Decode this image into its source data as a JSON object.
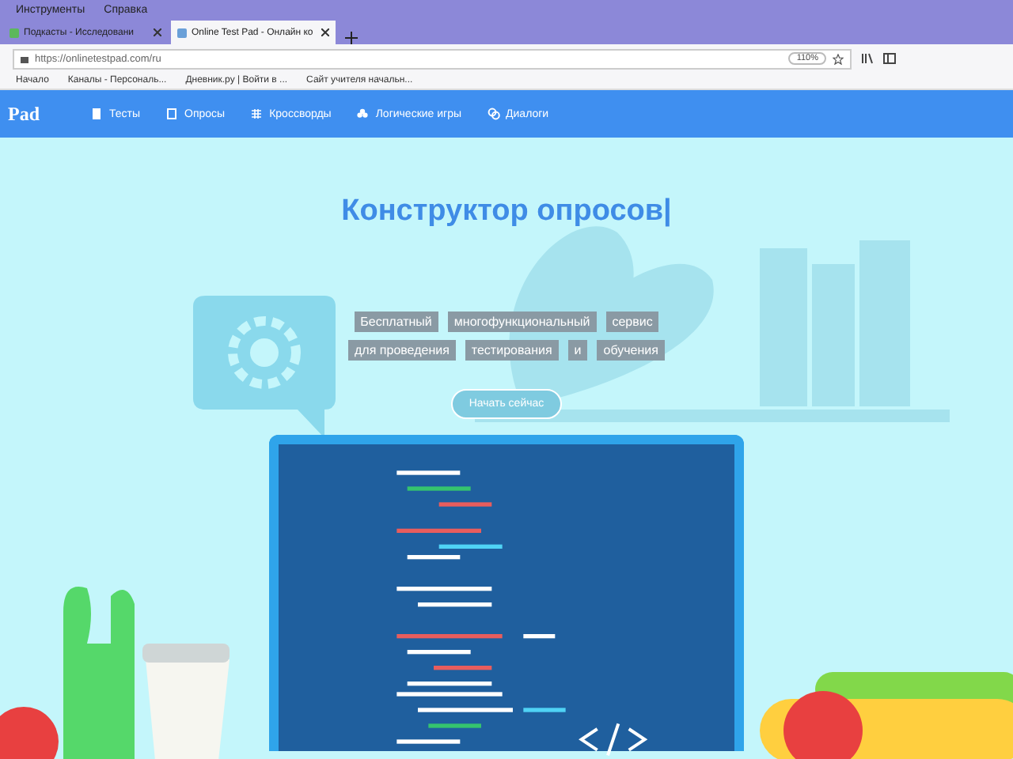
{
  "menu_bar": {
    "items": [
      "Инструменты",
      "Справка"
    ]
  },
  "tabs": [
    {
      "title": "Подкасты - Исследовани",
      "selected": false
    },
    {
      "title": "Online Test Pad - Онлайн ко",
      "selected": true
    }
  ],
  "address_bar": {
    "url": "https://onlinetestpad.com/ru",
    "zoom": "110%"
  },
  "bookmarks": [
    "Начало",
    "Каналы - Персональ...",
    "Дневник.ру | Войти в ...",
    "Сайт учителя начальн..."
  ],
  "site_nav": {
    "logo": "Pad",
    "items": [
      "Тесты",
      "Опросы",
      "Кроссворды",
      "Логические игры",
      "Диалоги"
    ]
  },
  "hero": {
    "title": "Конструктор опросов|",
    "tag_rows": [
      [
        "Бесплатный",
        "многофункциональный",
        "сервис"
      ],
      [
        "для проведения",
        "тестирования",
        "и",
        "обучения"
      ]
    ],
    "button": "Начать сейчас"
  }
}
